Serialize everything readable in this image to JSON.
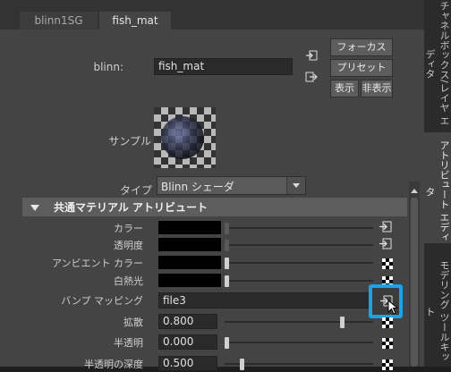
{
  "tabs": {
    "t1": "blinn1SG",
    "t2": "fish_mat"
  },
  "header": {
    "type_label": "blinn:",
    "name_value": "fish_mat",
    "focus_btn": "フォーカス",
    "preset_btn": "プリセット",
    "show_btn": "表示",
    "hide_btn": "非表示"
  },
  "sample_label": "サンプル",
  "type_row": {
    "label": "タイプ",
    "value": "Blinn シェーダ"
  },
  "section": {
    "title": "共通マテリアル アトリビュート"
  },
  "attrs": {
    "color": "カラー",
    "transparency": "透明度",
    "ambient": "アンビエント カラー",
    "incandescence": "白熱光",
    "bump": "バンプ マッピング",
    "bump_value": "file3",
    "diffuse": "拡散",
    "diffuse_value": "0.800",
    "translucence": "半透明",
    "translucence_value": "0.000",
    "translucence_depth": "半透明の深度",
    "translucence_depth_value": "0.500"
  },
  "side_tabs": {
    "tab1": "チャネルボックス/レイヤ エディタ",
    "tab2": "アトリビュート エディタ",
    "tab3": "モデリング ツールキット"
  },
  "highlight_color": "#1aa3e8"
}
